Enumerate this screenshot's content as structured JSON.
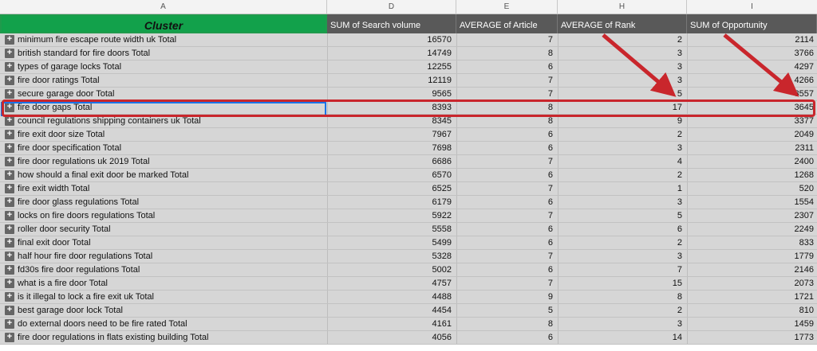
{
  "columns": {
    "a": "A",
    "d": "D",
    "e": "E",
    "h": "H",
    "i": "I"
  },
  "headers": {
    "cluster": "Cluster",
    "search_volume": "SUM of Search volume",
    "avg_article": "AVERAGE of Article",
    "avg_rank": "AVERAGE of Rank",
    "opportunity": "SUM of Opportunity"
  },
  "expand_icon": "+",
  "rows": [
    {
      "cluster": "minimum fire escape route width uk Total",
      "volume": "16570",
      "article": "7",
      "rank": "2",
      "opp": "2114"
    },
    {
      "cluster": "british standard for fire doors Total",
      "volume": "14749",
      "article": "8",
      "rank": "3",
      "opp": "3766"
    },
    {
      "cluster": "types of garage locks Total",
      "volume": "12255",
      "article": "6",
      "rank": "3",
      "opp": "4297"
    },
    {
      "cluster": "fire door ratings Total",
      "volume": "12119",
      "article": "7",
      "rank": "3",
      "opp": "4266"
    },
    {
      "cluster": "secure garage door Total",
      "volume": "9565",
      "article": "7",
      "rank": "5",
      "opp": "3557"
    },
    {
      "cluster": "fire door gaps Total",
      "volume": "8393",
      "article": "8",
      "rank": "17",
      "opp": "3645"
    },
    {
      "cluster": "council regulations shipping containers uk Total",
      "volume": "8345",
      "article": "8",
      "rank": "9",
      "opp": "3377"
    },
    {
      "cluster": "fire exit door size Total",
      "volume": "7967",
      "article": "6",
      "rank": "2",
      "opp": "2049"
    },
    {
      "cluster": "fire door specification Total",
      "volume": "7698",
      "article": "6",
      "rank": "3",
      "opp": "2311"
    },
    {
      "cluster": "fire door regulations uk 2019 Total",
      "volume": "6686",
      "article": "7",
      "rank": "4",
      "opp": "2400"
    },
    {
      "cluster": "how should a final exit door be marked Total",
      "volume": "6570",
      "article": "6",
      "rank": "2",
      "opp": "1268"
    },
    {
      "cluster": "fire exit width Total",
      "volume": "6525",
      "article": "7",
      "rank": "1",
      "opp": "520"
    },
    {
      "cluster": "fire door glass regulations Total",
      "volume": "6179",
      "article": "6",
      "rank": "3",
      "opp": "1554"
    },
    {
      "cluster": "locks on fire doors regulations Total",
      "volume": "5922",
      "article": "7",
      "rank": "5",
      "opp": "2307"
    },
    {
      "cluster": "roller door security Total",
      "volume": "5558",
      "article": "6",
      "rank": "6",
      "opp": "2249"
    },
    {
      "cluster": "final exit door Total",
      "volume": "5499",
      "article": "6",
      "rank": "2",
      "opp": "833"
    },
    {
      "cluster": "half hour fire door regulations Total",
      "volume": "5328",
      "article": "7",
      "rank": "3",
      "opp": "1779"
    },
    {
      "cluster": "fd30s fire door regulations Total",
      "volume": "5002",
      "article": "6",
      "rank": "7",
      "opp": "2146"
    },
    {
      "cluster": "what is a fire door Total",
      "volume": "4757",
      "article": "7",
      "rank": "15",
      "opp": "2073"
    },
    {
      "cluster": "is it illegal to lock a fire exit uk Total",
      "volume": "4488",
      "article": "9",
      "rank": "8",
      "opp": "1721"
    },
    {
      "cluster": "best garage door lock Total",
      "volume": "4454",
      "article": "5",
      "rank": "2",
      "opp": "810"
    },
    {
      "cluster": "do external doors need to be fire rated Total",
      "volume": "4161",
      "article": "8",
      "rank": "3",
      "opp": "1459"
    },
    {
      "cluster": "fire door regulations in flats existing building Total",
      "volume": "4056",
      "article": "6",
      "rank": "14",
      "opp": "1773"
    }
  ],
  "colors": {
    "header_green": "#12a14b",
    "header_dark": "#595959",
    "row_bg": "#d6d6d6",
    "highlight": "#c9262c",
    "selection": "#1a73e8"
  }
}
